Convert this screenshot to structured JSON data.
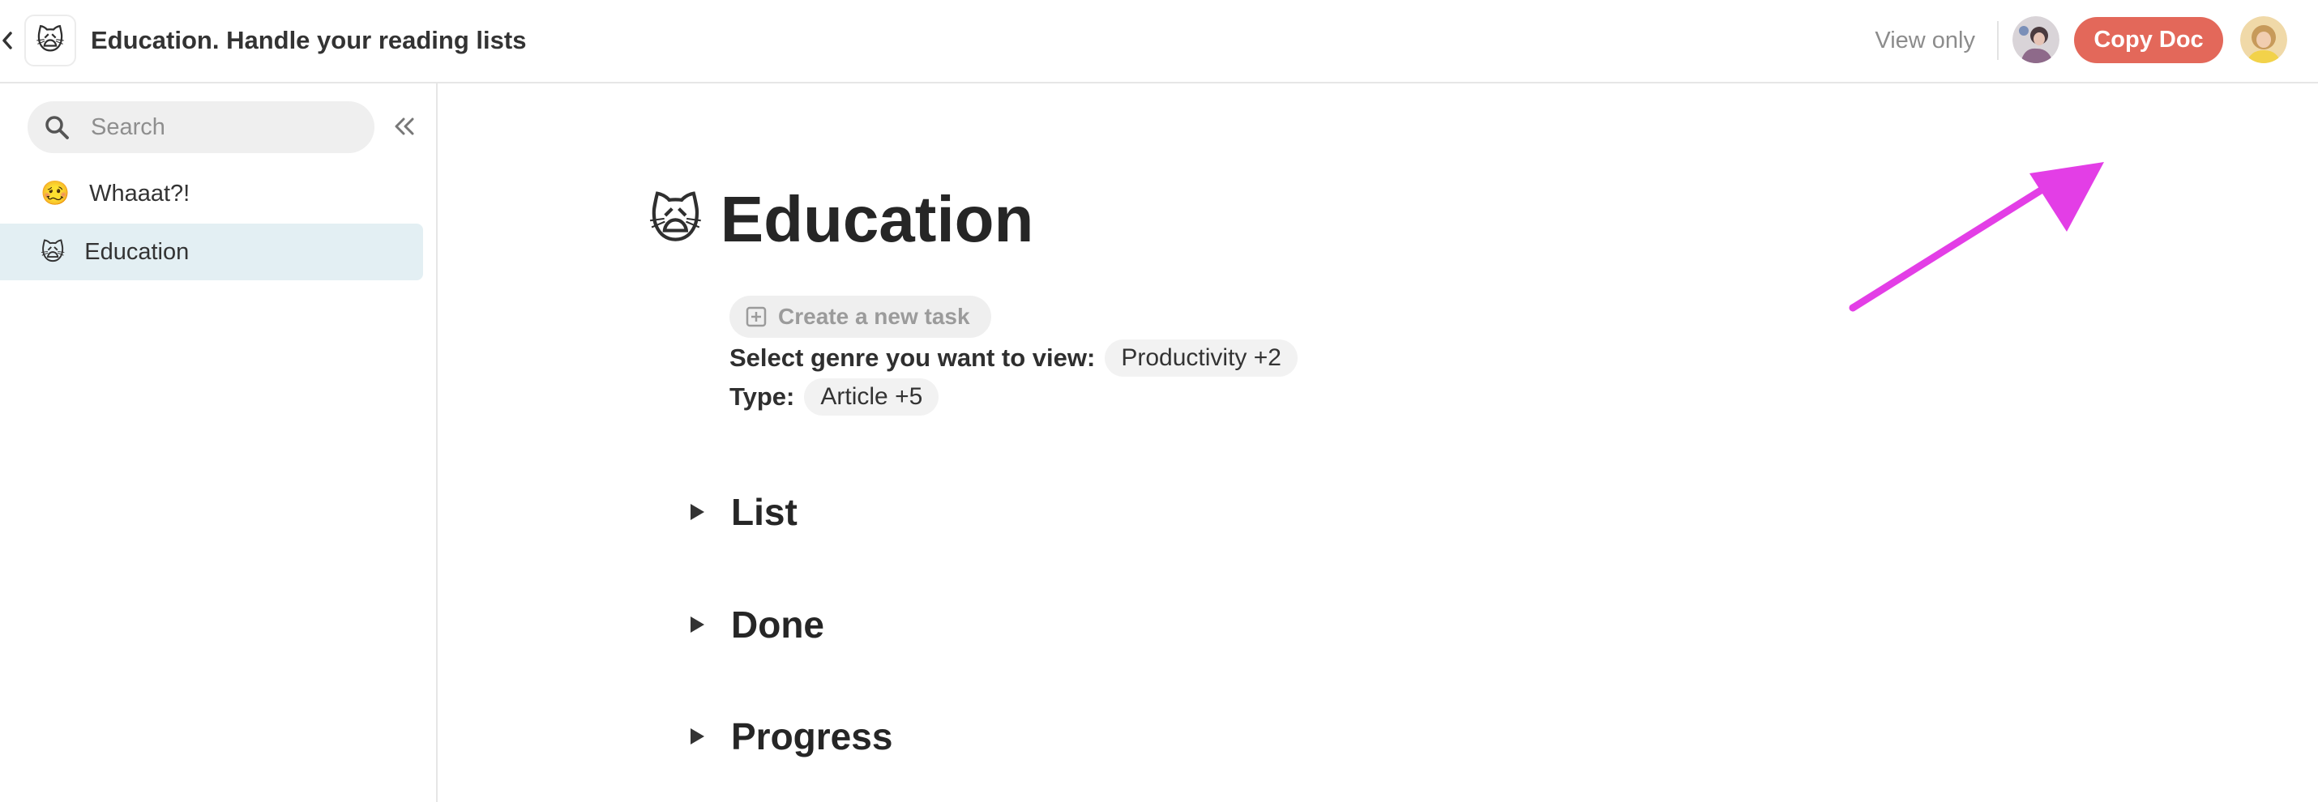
{
  "header": {
    "title": "Education. Handle your reading lists",
    "doc_emoji": "🙀",
    "view_only_label": "View only",
    "copy_button_label": "Copy Doc",
    "back_icon": "chevron-left-icon"
  },
  "sidebar": {
    "search_placeholder": "Search",
    "search_icon": "search-icon",
    "collapse_icon": "double-chevron-left-icon",
    "items": [
      {
        "emoji": "🥴",
        "label": "Whaaat?!"
      },
      {
        "emoji": "🙀",
        "label": "Education"
      }
    ],
    "selected_index": 1
  },
  "main": {
    "page_emoji": "🙀",
    "page_title": "Education",
    "create_task_label": "Create a new task",
    "filters": [
      {
        "label": "Select genre you want to view:",
        "chip": "Productivity +2"
      },
      {
        "label": "Type:",
        "chip": "Article +5"
      }
    ],
    "sections": [
      {
        "title": "List"
      },
      {
        "title": "Done"
      },
      {
        "title": "Progress"
      }
    ]
  },
  "colors": {
    "accent": "#e3685a",
    "selected_item_bg": "#e3eff3",
    "annotation_arrow": "#e33ee6"
  }
}
